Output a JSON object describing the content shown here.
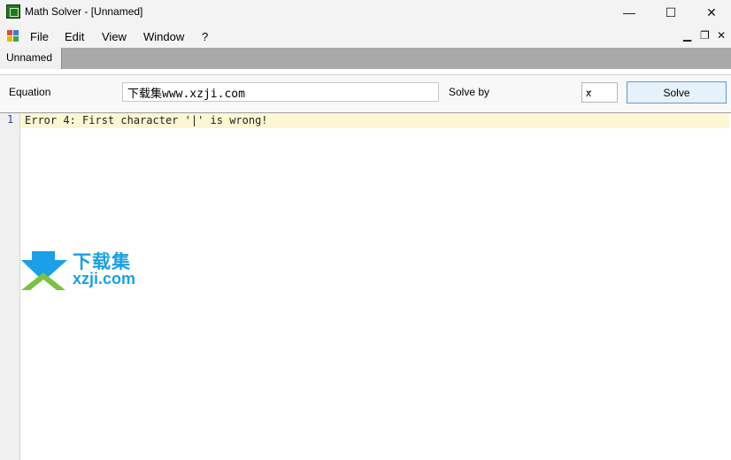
{
  "window": {
    "title": "Math Solver - [Unnamed]",
    "minimize_glyph": "—",
    "maximize_glyph": "☐",
    "close_glyph": "✕"
  },
  "menu": {
    "items": [
      "File",
      "Edit",
      "View",
      "Window",
      "?"
    ],
    "mdi_minimize": "▁",
    "mdi_restore": "❐",
    "mdi_close": "✕"
  },
  "tabs": [
    {
      "label": "Unnamed",
      "active": true
    }
  ],
  "toolbar": {
    "equation_label": "Equation",
    "equation_value": "下载集www.xzji.com",
    "solve_by_label": "Solve by",
    "solve_by_value": "x",
    "solve_button_label": "Solve"
  },
  "editor": {
    "lines": [
      {
        "number": "1",
        "text": "Error 4: First character '|' is wrong!"
      }
    ]
  },
  "watermark": {
    "text_cn": "下载集",
    "text_en": "xzji.com"
  },
  "colors": {
    "accent": "#5b9bd5",
    "watermark": "#1aa0e6",
    "highlight": "#fdf6d3"
  }
}
